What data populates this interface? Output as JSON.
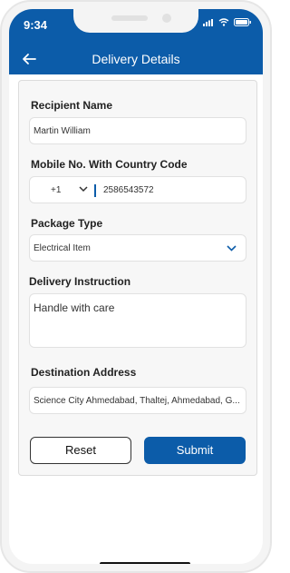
{
  "status_bar": {
    "time": "9:34"
  },
  "header": {
    "title": "Delivery Details"
  },
  "form": {
    "recipient": {
      "label": "Recipient Name",
      "value": "Martin William"
    },
    "mobile": {
      "label": "Mobile No. With Country Code",
      "country_code": "+1",
      "value": "2586543572"
    },
    "package": {
      "label": "Package Type",
      "value": "Electrical Item"
    },
    "instruction": {
      "label": "Delivery Instruction",
      "value": "Handle with care"
    },
    "address": {
      "label": "Destination Address",
      "value": "Science City Ahmedabad, Thaltej, Ahmedabad, G..."
    }
  },
  "buttons": {
    "reset": "Reset",
    "submit": "Submit"
  },
  "colors": {
    "primary": "#0c5ca9"
  },
  "icons": {
    "back": "arrow-left-icon",
    "dropdown": "chevron-down-icon"
  }
}
